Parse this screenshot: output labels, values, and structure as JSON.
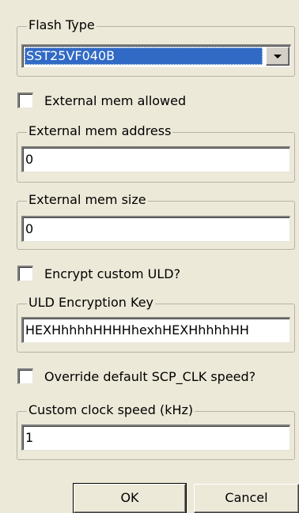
{
  "flash_type": {
    "label": "Flash Type",
    "selected": "SST25VF040B"
  },
  "external_mem_allowed": {
    "label": "External mem allowed",
    "checked": false
  },
  "external_mem_address": {
    "label": "External mem address",
    "value": "0"
  },
  "external_mem_size": {
    "label": "External mem size",
    "value": "0"
  },
  "encrypt_custom_uld": {
    "label": "Encrypt custom ULD?",
    "checked": false
  },
  "uld_encryption_key": {
    "label": "ULD Encryption Key",
    "value": "HEXHhhhhHHHHhexhHEXHhhhhHH"
  },
  "override_clock": {
    "label": "Override default SCP_CLK speed?",
    "checked": false
  },
  "custom_clock_speed": {
    "label": "Custom clock speed (kHz)",
    "value": "1"
  },
  "buttons": {
    "ok": "OK",
    "cancel": "Cancel"
  },
  "icons": {
    "dropdown": "chevron-down-icon"
  }
}
